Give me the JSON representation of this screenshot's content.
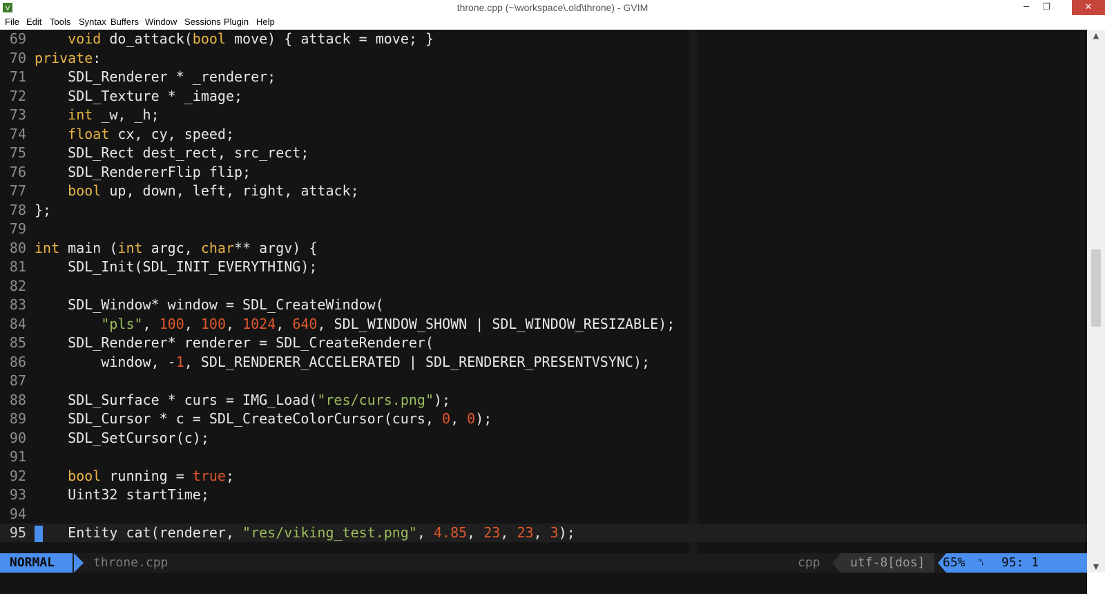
{
  "window": {
    "title": "throne.cpp (~\\workspace\\.old\\throne) - GVIM",
    "minimize_glyph": "─",
    "maximize_glyph": "❐",
    "close_glyph": "✕"
  },
  "menu": [
    "File",
    "Edit",
    "Tools",
    "Syntax",
    "Buffers",
    "Window",
    "Sessions",
    "Plugin",
    "Help"
  ],
  "editor": {
    "lines": [
      {
        "n": "69",
        "tokens": [
          {
            "t": "    "
          },
          {
            "t": "void",
            "c": "kw"
          },
          {
            "t": " do_attack("
          },
          {
            "t": "bool",
            "c": "kw"
          },
          {
            "t": " move) { attack = move; }"
          }
        ]
      },
      {
        "n": "70",
        "tokens": [
          {
            "t": "private",
            "c": "kw"
          },
          {
            "t": ":"
          }
        ]
      },
      {
        "n": "71",
        "tokens": [
          {
            "t": "    SDL_Renderer * _renderer;"
          }
        ]
      },
      {
        "n": "72",
        "tokens": [
          {
            "t": "    SDL_Texture * _image;"
          }
        ]
      },
      {
        "n": "73",
        "tokens": [
          {
            "t": "    "
          },
          {
            "t": "int",
            "c": "kw"
          },
          {
            "t": " _w, _h;"
          }
        ]
      },
      {
        "n": "74",
        "tokens": [
          {
            "t": "    "
          },
          {
            "t": "float",
            "c": "kw"
          },
          {
            "t": " cx, cy, speed;"
          }
        ]
      },
      {
        "n": "75",
        "tokens": [
          {
            "t": "    SDL_Rect dest_rect, src_rect;"
          }
        ]
      },
      {
        "n": "76",
        "tokens": [
          {
            "t": "    SDL_RendererFlip flip;"
          }
        ]
      },
      {
        "n": "77",
        "tokens": [
          {
            "t": "    "
          },
          {
            "t": "bool",
            "c": "kw"
          },
          {
            "t": " up, down, left, right, attack;"
          }
        ]
      },
      {
        "n": "78",
        "tokens": [
          {
            "t": "};"
          }
        ]
      },
      {
        "n": "79",
        "tokens": []
      },
      {
        "n": "80",
        "tokens": [
          {
            "t": "int",
            "c": "kw"
          },
          {
            "t": " main ("
          },
          {
            "t": "int",
            "c": "kw"
          },
          {
            "t": " argc, "
          },
          {
            "t": "char",
            "c": "kw"
          },
          {
            "t": "** argv) {"
          }
        ]
      },
      {
        "n": "81",
        "tokens": [
          {
            "t": "    SDL_Init(SDL_INIT_EVERYTHING);"
          }
        ]
      },
      {
        "n": "82",
        "tokens": []
      },
      {
        "n": "83",
        "tokens": [
          {
            "t": "    SDL_Window* window = SDL_CreateWindow("
          }
        ]
      },
      {
        "n": "84",
        "tokens": [
          {
            "t": "        "
          },
          {
            "t": "\"pls\"",
            "c": "str"
          },
          {
            "t": ", "
          },
          {
            "t": "100",
            "c": "num"
          },
          {
            "t": ", "
          },
          {
            "t": "100",
            "c": "num"
          },
          {
            "t": ", "
          },
          {
            "t": "1024",
            "c": "num"
          },
          {
            "t": ", "
          },
          {
            "t": "640",
            "c": "num"
          },
          {
            "t": ", SDL_WINDOW_SHOWN | SDL_WINDOW_RESIZABLE);"
          }
        ]
      },
      {
        "n": "85",
        "tokens": [
          {
            "t": "    SDL_Renderer* renderer = SDL_CreateRenderer("
          }
        ]
      },
      {
        "n": "86",
        "tokens": [
          {
            "t": "        window, -"
          },
          {
            "t": "1",
            "c": "num"
          },
          {
            "t": ", SDL_RENDERER_ACCELERATED | SDL_RENDERER_PRESENTVSYNC);"
          }
        ]
      },
      {
        "n": "87",
        "tokens": []
      },
      {
        "n": "88",
        "tokens": [
          {
            "t": "    SDL_Surface * curs = IMG_Load("
          },
          {
            "t": "\"res/curs.png\"",
            "c": "str"
          },
          {
            "t": ");"
          }
        ]
      },
      {
        "n": "89",
        "tokens": [
          {
            "t": "    SDL_Cursor * c = SDL_CreateColorCursor(curs, "
          },
          {
            "t": "0",
            "c": "num"
          },
          {
            "t": ", "
          },
          {
            "t": "0",
            "c": "num"
          },
          {
            "t": ");"
          }
        ]
      },
      {
        "n": "90",
        "tokens": [
          {
            "t": "    SDL_SetCursor(c);"
          }
        ]
      },
      {
        "n": "91",
        "tokens": []
      },
      {
        "n": "92",
        "tokens": [
          {
            "t": "    "
          },
          {
            "t": "bool",
            "c": "kw"
          },
          {
            "t": " running = "
          },
          {
            "t": "true",
            "c": "num"
          },
          {
            "t": ";"
          }
        ]
      },
      {
        "n": "93",
        "tokens": [
          {
            "t": "    Uint32 startTime;"
          }
        ]
      },
      {
        "n": "94",
        "tokens": []
      },
      {
        "n": "95",
        "cursor": true,
        "tokens": [
          {
            "t": "    Entity cat(renderer, "
          },
          {
            "t": "\"res/viking_test.png\"",
            "c": "str"
          },
          {
            "t": ", "
          },
          {
            "t": "4.85",
            "c": "num"
          },
          {
            "t": ", "
          },
          {
            "t": "23",
            "c": "num"
          },
          {
            "t": ", "
          },
          {
            "t": "23",
            "c": "num"
          },
          {
            "t": ", "
          },
          {
            "t": "3",
            "c": "num"
          },
          {
            "t": ");"
          }
        ]
      }
    ]
  },
  "statusline": {
    "mode": "NORMAL",
    "filename": "throne.cpp",
    "filetype": "cpp",
    "encoding": "utf-8[dos]",
    "percent": "65%",
    "line_glyph": "␤",
    "position": "95:  1"
  },
  "scrollbar": {
    "position_fraction": 0.4,
    "visible_fraction": 0.15
  },
  "colors": {
    "accent": "#4a8ff0",
    "keyword": "#e8b446",
    "string": "#9bbd5b",
    "number": "#e0572c",
    "background": "#141414"
  }
}
